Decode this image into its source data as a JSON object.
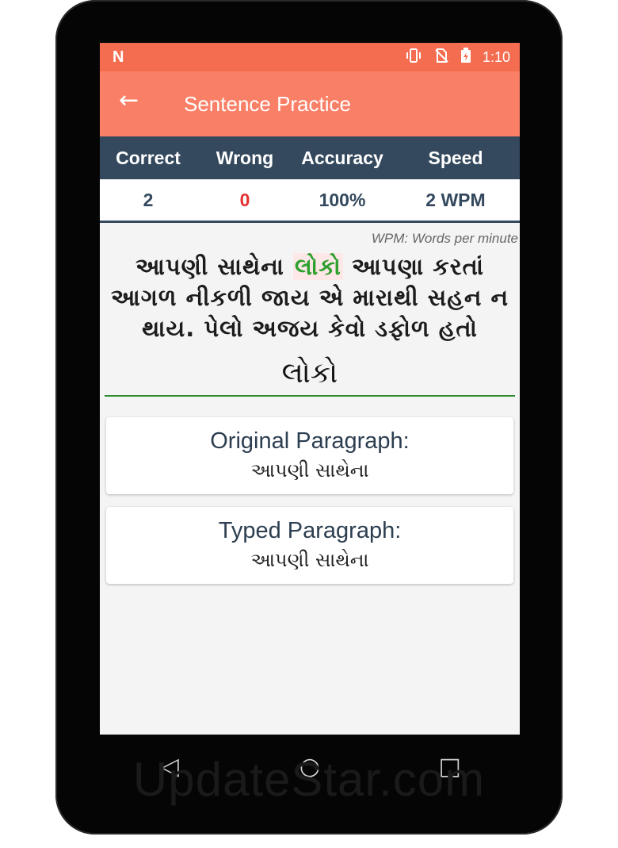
{
  "status": {
    "left_icon": "N",
    "time": "1:10",
    "icons": [
      "vibrate-icon",
      "no-sim-icon",
      "battery-icon"
    ]
  },
  "appbar": {
    "back_icon": "←",
    "title": "Sentence Practice"
  },
  "stats": {
    "headers": [
      "Correct",
      "Wrong",
      "Accuracy",
      "Speed"
    ],
    "correct": "2",
    "wrong": "0",
    "accuracy": "100%",
    "speed": "2 WPM",
    "note": "WPM: Words per minute"
  },
  "sentence": {
    "before": "આપણી સાથેના ",
    "highlight": "લોકો",
    "after": " આપણા કરતાં આગળ નીકળી જાય એ મારાથી સહન ન થાય. પેલો અજય કેવો ડફોળ હતો"
  },
  "current_word": "લોકો",
  "original": {
    "title": "Original Paragraph:",
    "text": "આપણી સાથેના"
  },
  "typed": {
    "title": "Typed Paragraph:",
    "text": "આપણી સાથેના"
  },
  "nav": {
    "back": "◁",
    "home": "○",
    "recents": "□"
  },
  "watermark": "UpdateStar.com",
  "colors": {
    "statusbar": "#f56d50",
    "appbar": "#fa7f67",
    "stats_header": "#34495e",
    "wrong": "#e53030",
    "highlight": "#2ea02e"
  }
}
